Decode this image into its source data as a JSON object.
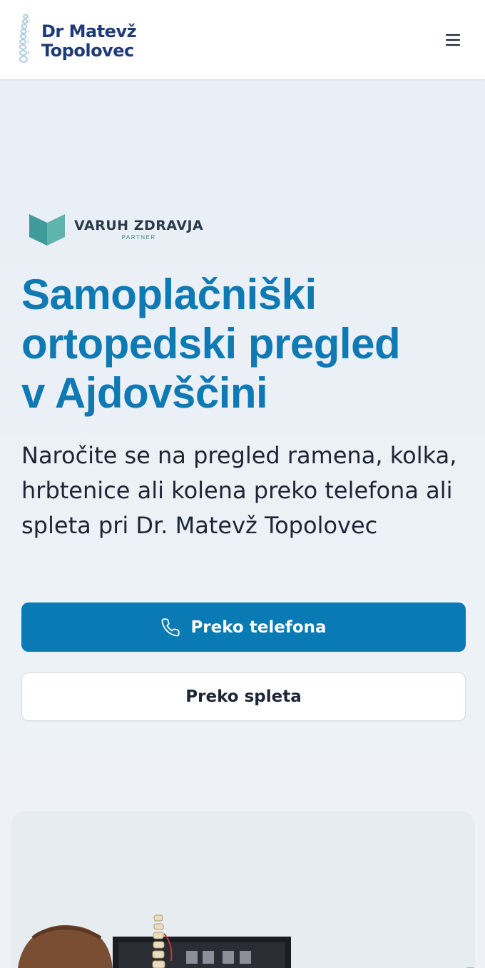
{
  "header": {
    "logo_line1": "Dr Matevž",
    "logo_line2": "Topolovec",
    "menu_icon": "hamburger-menu-icon",
    "brand_color": "#1e3a78"
  },
  "partner": {
    "name": "VARUH ZDRAVJA",
    "sub": "PARTNER"
  },
  "hero": {
    "headline_line1": "Samoplačniški",
    "headline_line2": "ortopedski pregled",
    "headline_line3": "v Ajdovščini",
    "description": "Naročite se na pregled ramena, kolka, hrbtenice ali kolena preko telefona ali spleta pri Dr. Matevž Topolovec",
    "accent_color": "#0f79b3"
  },
  "actions": {
    "phone_label": "Preko telefona",
    "phone_icon": "phone-icon",
    "web_label": "Preko spleta"
  },
  "colors": {
    "primary_button": "#0a7ab5",
    "page_background": "#eef2f7"
  }
}
